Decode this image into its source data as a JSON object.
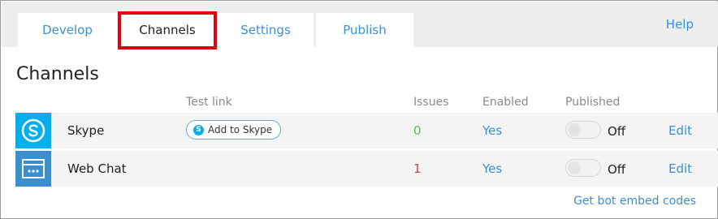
{
  "tabs": [
    {
      "label": "Develop"
    },
    {
      "label": "Channels"
    },
    {
      "label": "Settings"
    },
    {
      "label": "Publish"
    }
  ],
  "help": "Help",
  "page_title": "Channels",
  "columns": {
    "test_link": "Test link",
    "issues": "Issues",
    "enabled": "Enabled",
    "published": "Published"
  },
  "channels": [
    {
      "name": "Skype",
      "icon": "skype-icon",
      "test_link_label": "Add to Skype",
      "issues": "0",
      "enabled": "Yes",
      "published": "Off",
      "edit": "Edit"
    },
    {
      "name": "Web Chat",
      "icon": "web-chat-icon",
      "issues": "1",
      "enabled": "Yes",
      "published": "Off",
      "edit": "Edit"
    }
  ],
  "embed_link": "Get bot embed codes",
  "colors": {
    "accent": "#3b8fd6",
    "highlight": "#e3000f",
    "skype": "#00aff0",
    "webchat": "#3a8fd1",
    "issues_ok": "#5cb85c",
    "issues_bad": "#e33a3a"
  }
}
